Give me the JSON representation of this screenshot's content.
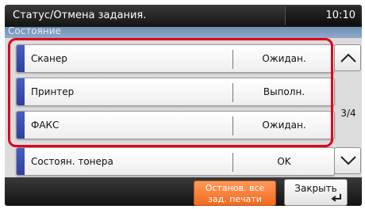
{
  "header": {
    "title": "Статус/Отмена задания.",
    "clock": "10:10",
    "section": "Состояние"
  },
  "rows": [
    {
      "name": "Сканер",
      "status": "Ожидан."
    },
    {
      "name": "Принтер",
      "status": "Выполн."
    },
    {
      "name": "ФАКС",
      "status": "Ожидан."
    },
    {
      "name": "Состоян. тонера",
      "status": "OK"
    }
  ],
  "pager": {
    "indicator": "3/4",
    "up_icon": "chevron-up-icon",
    "down_icon": "chevron-down-icon"
  },
  "footer": {
    "stop_line1": "Останов. все",
    "stop_line2": "зад. печати",
    "close_label": "Закрыть",
    "close_icon": "enter-return-icon"
  },
  "colors": {
    "accent_stripe": "#3a4cb0",
    "highlight": "#e0001b",
    "stop_button": "#f5772b",
    "subbar": "#7f9cc0"
  }
}
